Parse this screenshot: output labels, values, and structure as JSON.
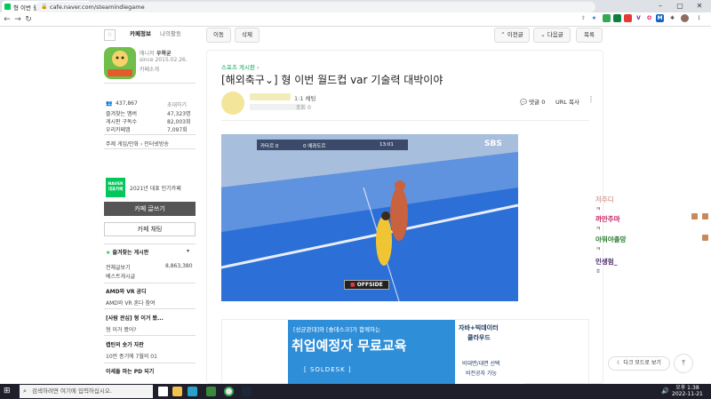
{
  "browser": {
    "tab_title": "형 이번 월드컵 var 기술력 대박이...",
    "url": "cafe.naver.com/steamindiegame",
    "ext_labels": [
      "V",
      "O",
      "M"
    ]
  },
  "cafe": {
    "tabs": [
      "카페정보",
      "나의활동"
    ],
    "manager_label": "매니저",
    "manager_name": "우왁굳",
    "since": "since 2015.02.26.",
    "intro_link": "카페소개",
    "members": "437,867",
    "invite": "초대하기",
    "stats": [
      {
        "label": "즐겨찾는 멤버",
        "value": "47,323명"
      },
      {
        "label": "게시판 구독수",
        "value": "82,003회"
      },
      {
        "label": "우리카페앱",
        "value": "7,097회"
      }
    ],
    "theme": "주제 게임/만화 › 인터넷방송",
    "award": "2021년 대표 인기카페",
    "naver_badge": "NAVER",
    "naver_badge2": "대표카페",
    "write_btn": "카페 글쓰기",
    "chat_btn": "카페 채팅",
    "fav_boards_title": "즐겨찾는 게시판",
    "fav_boards": [
      {
        "label": "전체글보기",
        "count": "8,863,380"
      },
      {
        "label": "베스트게시글",
        "count": ""
      }
    ],
    "sections": [
      {
        "title": "AMD와 VR 공디",
        "item": "AMD와 VR 혼다 참여"
      },
      {
        "title": "[사람 관심] 형 이거 봤...",
        "item": "형 이거 봤어?"
      },
      {
        "title": "캡틴의 숏가 자판",
        "item": "10만 종기에 7월의 01"
      },
      {
        "title": "이세돌 마는 PD 되기",
        "item": ""
      }
    ]
  },
  "toolbar": {
    "move": "이동",
    "delete": "삭제",
    "prev": "이전글",
    "next": "다음글",
    "list": "목록"
  },
  "article": {
    "breadcrumb": "스포츠 게시판 ›",
    "title": "[해외축구⌄] 형 이번 월드컵 var 기술력 대박이야",
    "grade": "1:1 채팅",
    "views": "조회 0",
    "reply": "댓글 0",
    "url_copy": "URL 복사",
    "video": {
      "channel": "SBS",
      "score_left": "카타르 0",
      "score_right": "0 에콰도르",
      "clock": "13:01",
      "offside": "OFFSIDE"
    },
    "ad": {
      "headline1": "[성균관대]와 [솔데스크]가 함께하는",
      "headline2": "취업예정자 무료교육",
      "brand": "[ SOLDESK ]",
      "side1": "자바+빅데이터",
      "side2": "클라우드",
      "side3": "비대면/대면 선택",
      "side4": "비전공자 가능"
    }
  },
  "chat": {
    "entries": [
      {
        "name": "저주디",
        "msg": "ㅋ",
        "color": "#d6a0a0"
      },
      {
        "name": "까만주마",
        "msg": "ㅋ",
        "color": "#c2185b"
      },
      {
        "name": "아뭐야졸망",
        "msg": "ㅋ",
        "color": "#2e7d32"
      },
      {
        "name": "인생험_",
        "msg": "ㅎ",
        "color": "#4a2a6a"
      }
    ]
  },
  "float": {
    "darkmode": "다크 모드로 보기",
    "top": "⤒"
  },
  "taskbar": {
    "search_placeholder": "검색하려면 여기에 입력하십시오.",
    "time": "오후 1:38",
    "date": "2022-11-21"
  }
}
